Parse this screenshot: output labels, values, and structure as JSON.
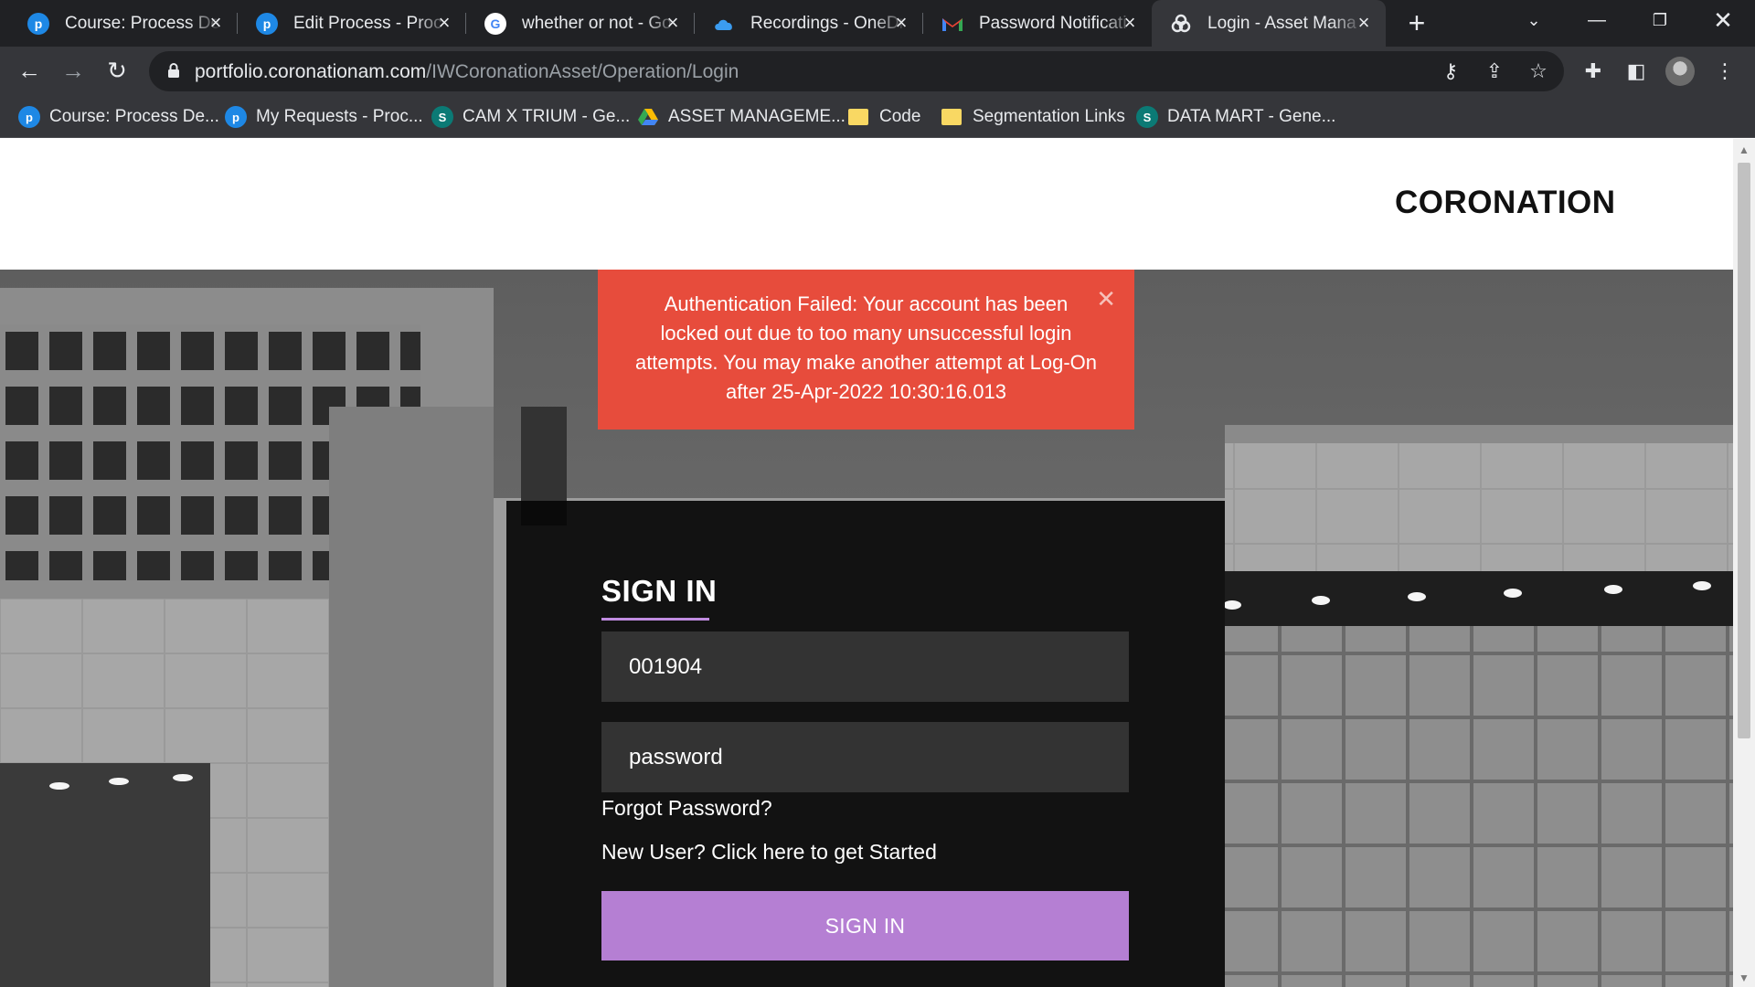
{
  "browser": {
    "tabs": [
      {
        "title": "Course: Process De",
        "icon": "process-p-icon",
        "active": false
      },
      {
        "title": "Edit Process - Proc",
        "icon": "process-p-icon",
        "active": false
      },
      {
        "title": "whether or not - Go",
        "icon": "google-g-icon",
        "active": false
      },
      {
        "title": "Recordings - OneDr",
        "icon": "onedrive-cloud-icon",
        "active": false
      },
      {
        "title": "Password Notificati",
        "icon": "gmail-icon",
        "active": false
      },
      {
        "title": "Login - Asset Mana",
        "icon": "coronation-icon",
        "active": true
      }
    ],
    "url_host": "portfolio.coronationam.com",
    "url_path": "/IWCoronationAsset/Operation/Login",
    "bookmarks": [
      {
        "label": "Course: Process De...",
        "icon": "process-p-icon"
      },
      {
        "label": "My Requests - Proc...",
        "icon": "process-p-icon"
      },
      {
        "label": "CAM X TRIUM - Ge...",
        "icon": "sharepoint-icon"
      },
      {
        "label": "ASSET MANAGEME...",
        "icon": "drive-icon"
      },
      {
        "label": "Code",
        "icon": "folder-icon"
      },
      {
        "label": "Segmentation Links",
        "icon": "folder-icon"
      },
      {
        "label": "DATA MART - Gene...",
        "icon": "sharepoint-icon"
      }
    ]
  },
  "colors": {
    "alert": "#e74c3c",
    "accent": "#b57fd3",
    "underline": "#c08ce0"
  },
  "page": {
    "logo": "CORONATION",
    "alert_message": "Authentication Failed: Your account has been locked out due to too many unsuccessful login attempts. You may make another attempt at Log-On after 25-Apr-2022 10:30:16.013",
    "signin_title": "SIGN IN",
    "username_value": "001904",
    "password_placeholder": "password",
    "forgot_link": "Forgot Password?",
    "new_user_link": "New User? Click here to get Started",
    "submit_label": "SIGN IN"
  }
}
